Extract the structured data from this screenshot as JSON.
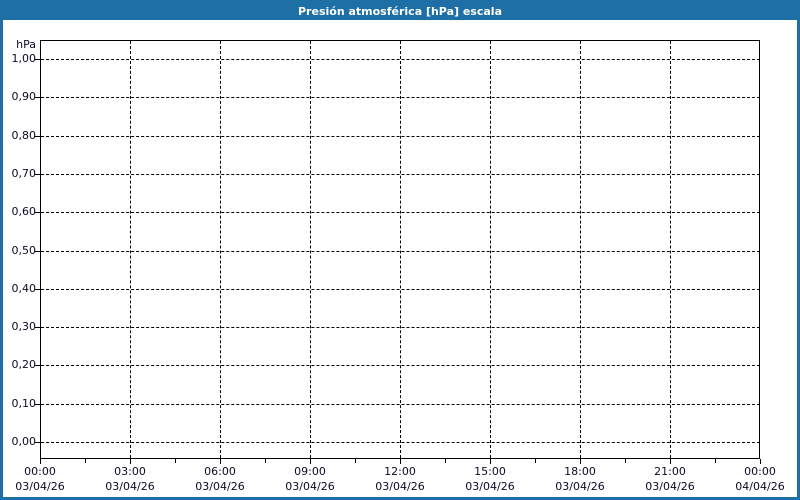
{
  "window": {
    "title": "Presión atmosférica [hPa] escala"
  },
  "colors": {
    "titlebar_bg": "#1d6fa5",
    "titlebar_text": "#ffffff",
    "frame_border": "#1d6fa5",
    "chart_bg": "#ffffff",
    "axis_line": "#000000",
    "grid_line": "#000000",
    "label_text": "#0a0a28"
  },
  "chart_data": {
    "type": "line",
    "title": "Presión atmosférica [hPa] escala",
    "ylabel": "hPa",
    "xlabel": "",
    "ylim": [
      0,
      1
    ],
    "y_tick_labels": [
      "1,00",
      "0,90",
      "0,80",
      "0,70",
      "0,60",
      "0,50",
      "0,40",
      "0,30",
      "0,20",
      "0,10",
      "0,00"
    ],
    "y_tick_values": [
      1.0,
      0.9,
      0.8,
      0.7,
      0.6,
      0.5,
      0.4,
      0.3,
      0.2,
      0.1,
      0.0
    ],
    "x_tick_labels": [
      {
        "time": "00:00",
        "date": "03/04/26"
      },
      {
        "time": "03:00",
        "date": "03/04/26"
      },
      {
        "time": "06:00",
        "date": "03/04/26"
      },
      {
        "time": "09:00",
        "date": "03/04/26"
      },
      {
        "time": "12:00",
        "date": "03/04/26"
      },
      {
        "time": "15:00",
        "date": "03/04/26"
      },
      {
        "time": "18:00",
        "date": "03/04/26"
      },
      {
        "time": "21:00",
        "date": "03/04/26"
      },
      {
        "time": "00:00",
        "date": "04/04/26"
      }
    ],
    "x_major_interval_hours": 3,
    "x_minor_interval_hours": 1.5,
    "grid": "dashed",
    "legend": "none",
    "series": []
  }
}
